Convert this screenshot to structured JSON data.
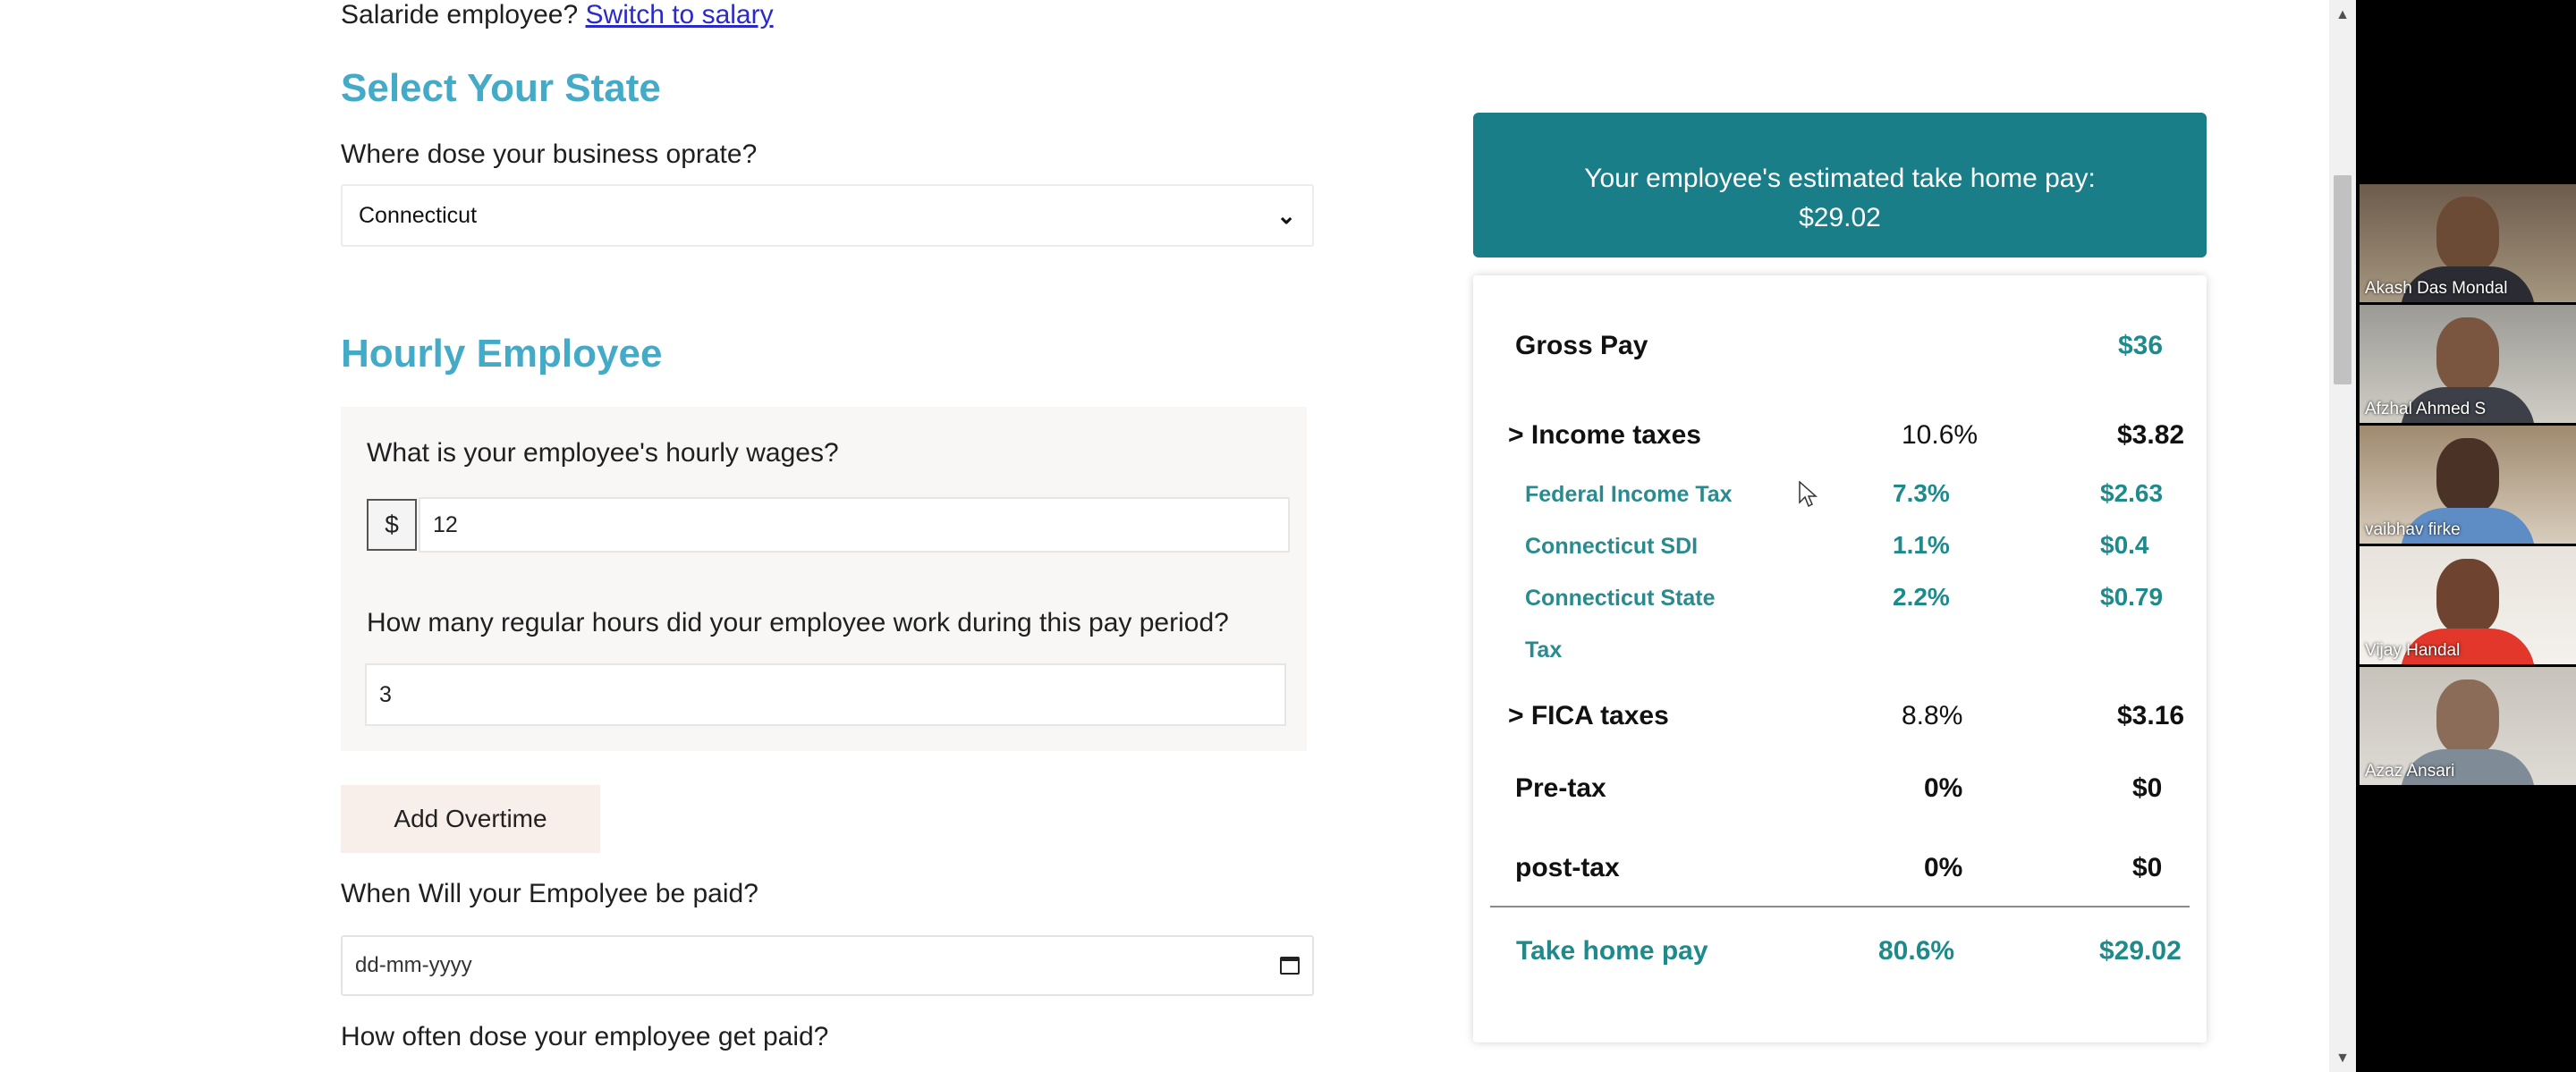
{
  "form": {
    "switch_prefix": "Salaride employee?",
    "switch_link": "Switch to salary",
    "state_heading": "Select Your State",
    "state_question": "Where dose your business oprate?",
    "state_value": "Connecticut",
    "hourly_heading": "Hourly Employee",
    "wage_question": "What is your employee's hourly wages?",
    "wage_prefix": "$",
    "wage_value": "12",
    "hours_question": "How many regular hours did your employee work during this pay period?",
    "hours_value": "3",
    "overtime_button": "Add Overtime",
    "paid_question": "When Will your Empolyee be paid?",
    "date_placeholder": "dd-mm-yyyy",
    "often_question": "How often dose your employee get paid?"
  },
  "summary": {
    "banner_line1": "Your employee's estimated take home pay:",
    "banner_amount": "$29.02",
    "gross_label": "Gross Pay",
    "gross_amount": "$36",
    "income_label": "> Income taxes",
    "income_pct": "10.6%",
    "income_amount": "$3.82",
    "federal_label": "Federal Income Tax",
    "federal_pct": "7.3%",
    "federal_amount": "$2.63",
    "sdi_label": "Connecticut SDI",
    "sdi_pct": "1.1%",
    "sdi_amount": "$0.4",
    "state_tax_label_1": "Connecticut State",
    "state_tax_label_2": "Tax",
    "state_tax_pct": "2.2%",
    "state_tax_amount": "$0.79",
    "fica_label": "> FICA taxes",
    "fica_pct": "8.8%",
    "fica_amount": "$3.16",
    "pretax_label": "Pre-tax",
    "pretax_pct": "0%",
    "pretax_amount": "$0",
    "posttax_label": "post-tax",
    "posttax_pct": "0%",
    "posttax_amount": "$0",
    "takehome_label": "Take home pay",
    "takehome_pct": "80.6%",
    "takehome_amount": "$29.02"
  },
  "participants": [
    {
      "name": "Akash Das Mondal"
    },
    {
      "name": "Afzhal Ahmed S"
    },
    {
      "name": "vaibhav firke"
    },
    {
      "name": "Vijay Handal"
    },
    {
      "name": "Azaz Ansari"
    }
  ],
  "colors": {
    "heading": "#43aac7",
    "banner": "#197e88",
    "sub_rows": "#2a8b8f"
  }
}
